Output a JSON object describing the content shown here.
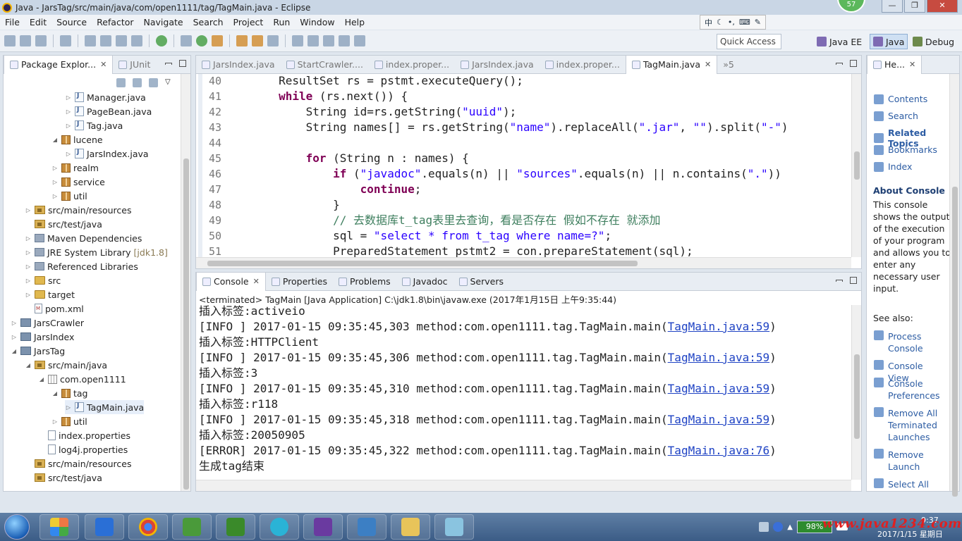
{
  "window": {
    "title": "Java - JarsTag/src/main/java/com/open1111/tag/TagMain.java - Eclipse",
    "badge": "57"
  },
  "menu": [
    "File",
    "Edit",
    "Source",
    "Refactor",
    "Navigate",
    "Search",
    "Project",
    "Run",
    "Window",
    "Help"
  ],
  "ime": {
    "label": "中"
  },
  "toolbar": {
    "quick_access": "Quick Access",
    "perspectives": [
      "Java EE",
      "Java",
      "Debug"
    ]
  },
  "explorer": {
    "tabs": [
      "Package Explor...",
      "JUnit"
    ],
    "items": [
      {
        "label": "Manager.java",
        "icon": "java-file-icon"
      },
      {
        "label": "PageBean.java",
        "icon": "java-file-icon"
      },
      {
        "label": "Tag.java",
        "icon": "java-file-icon"
      },
      {
        "label": "lucene",
        "icon": "package-icon"
      },
      {
        "label": "JarsIndex.java",
        "icon": "java-file-icon"
      },
      {
        "label": "realm",
        "icon": "package-icon"
      },
      {
        "label": "service",
        "icon": "package-icon"
      },
      {
        "label": "util",
        "icon": "package-icon"
      },
      {
        "label": "src/main/resources",
        "icon": "source-folder-icon"
      },
      {
        "label": "src/test/java",
        "icon": "source-folder-icon"
      },
      {
        "label": "Maven Dependencies",
        "icon": "library-icon"
      },
      {
        "label": "JRE System Library",
        "suffix": "[jdk1.8]",
        "icon": "library-icon"
      },
      {
        "label": "Referenced Libraries",
        "icon": "library-icon"
      },
      {
        "label": "src",
        "icon": "folder-icon"
      },
      {
        "label": "target",
        "icon": "folder-icon"
      },
      {
        "label": "pom.xml",
        "icon": "xml-file-icon"
      },
      {
        "label": "JarsCrawler",
        "icon": "project-icon"
      },
      {
        "label": "JarsIndex",
        "icon": "project-icon"
      },
      {
        "label": "JarsTag",
        "icon": "project-icon"
      },
      {
        "label": "src/main/java",
        "icon": "source-folder-icon"
      },
      {
        "label": "com.open1111",
        "icon": "package-node-icon"
      },
      {
        "label": "tag",
        "icon": "package-icon"
      },
      {
        "label": "TagMain.java",
        "icon": "java-file-icon"
      },
      {
        "label": "util",
        "icon": "package-icon"
      },
      {
        "label": "index.properties",
        "icon": "file-icon"
      },
      {
        "label": "log4j.properties",
        "icon": "file-icon"
      },
      {
        "label": "src/main/resources",
        "icon": "source-folder-icon"
      },
      {
        "label": "src/test/java",
        "icon": "source-folder-icon"
      }
    ]
  },
  "editor": {
    "tabs": [
      "JarsIndex.java",
      "StartCrawler....",
      "index.proper...",
      "JarsIndex.java",
      "index.proper...",
      "TagMain.java"
    ],
    "overflow": "»5",
    "active_tab": "TagMain.java",
    "lines": [
      {
        "num": "40",
        "code": "        ResultSet rs = pstmt.executeQuery();"
      },
      {
        "num": "41",
        "code": "        while (rs.next()) {"
      },
      {
        "num": "42",
        "code": "            String id=rs.getString(\"uuid\");"
      },
      {
        "num": "43",
        "code": "            String names[] = rs.getString(\"name\").replaceAll(\".jar\", \"\").split(\"-\")"
      },
      {
        "num": "44",
        "code": ""
      },
      {
        "num": "45",
        "code": "            for (String n : names) {"
      },
      {
        "num": "46",
        "code": "                if (\"javadoc\".equals(n) || \"sources\".equals(n) || n.contains(\".\"))"
      },
      {
        "num": "47",
        "code": "                    continue;"
      },
      {
        "num": "48",
        "code": "                }"
      },
      {
        "num": "49",
        "code": "                // 去数据库t_tag表里去查询，看是否存在 假如不存在 就添加"
      },
      {
        "num": "50",
        "code": "                sql = \"select * from t_tag where name=?\";"
      },
      {
        "num": "51",
        "code": "                PreparedStatement pstmt2 = con.prepareStatement(sql);"
      }
    ]
  },
  "console": {
    "tabs": [
      "Console",
      "Properties",
      "Problems",
      "Javadoc",
      "Servers"
    ],
    "status": "<terminated> TagMain [Java Application] C:\\jdk1.8\\bin\\javaw.exe (2017年1月15日 上午9:35:44)",
    "lines": [
      {
        "text": "插入标签:activeio",
        "link": ""
      },
      {
        "text": "[INFO ] 2017-01-15 09:35:45,303 method:com.open1111.tag.TagMain.main(",
        "link": "TagMain.java:59",
        "tail": ")"
      },
      {
        "text": "插入标签:HTTPClient",
        "link": ""
      },
      {
        "text": "[INFO ] 2017-01-15 09:35:45,306 method:com.open1111.tag.TagMain.main(",
        "link": "TagMain.java:59",
        "tail": ")"
      },
      {
        "text": "插入标签:3",
        "link": ""
      },
      {
        "text": "[INFO ] 2017-01-15 09:35:45,310 method:com.open1111.tag.TagMain.main(",
        "link": "TagMain.java:59",
        "tail": ")"
      },
      {
        "text": "插入标签:r118",
        "link": ""
      },
      {
        "text": "[INFO ] 2017-01-15 09:35:45,318 method:com.open1111.tag.TagMain.main(",
        "link": "TagMain.java:59",
        "tail": ")"
      },
      {
        "text": "插入标签:20050905",
        "link": ""
      },
      {
        "text": "[ERROR] 2017-01-15 09:35:45,322 method:com.open1111.tag.TagMain.main(",
        "link": "TagMain.java:76",
        "tail": ")"
      },
      {
        "text": "生成tag结束",
        "link": ""
      }
    ]
  },
  "help": {
    "tab": "He...",
    "links": [
      "Contents",
      "Search",
      "Related Topics",
      "Bookmarks",
      "Index"
    ],
    "about_title": "About Console",
    "about_text": "This console shows the output of the execution of your program and allows you to enter any necessary user input.",
    "see_also": "See also:",
    "see_also_links": [
      "Process Console",
      "Console View",
      "Console Preferences",
      "Remove All Terminated Launches",
      "Remove Launch",
      "Select All"
    ]
  },
  "taskbar": {
    "battery": "98%",
    "watermark": "www.java1234.com",
    "date": "2017/1/15 星期日",
    "time": "9:37"
  }
}
